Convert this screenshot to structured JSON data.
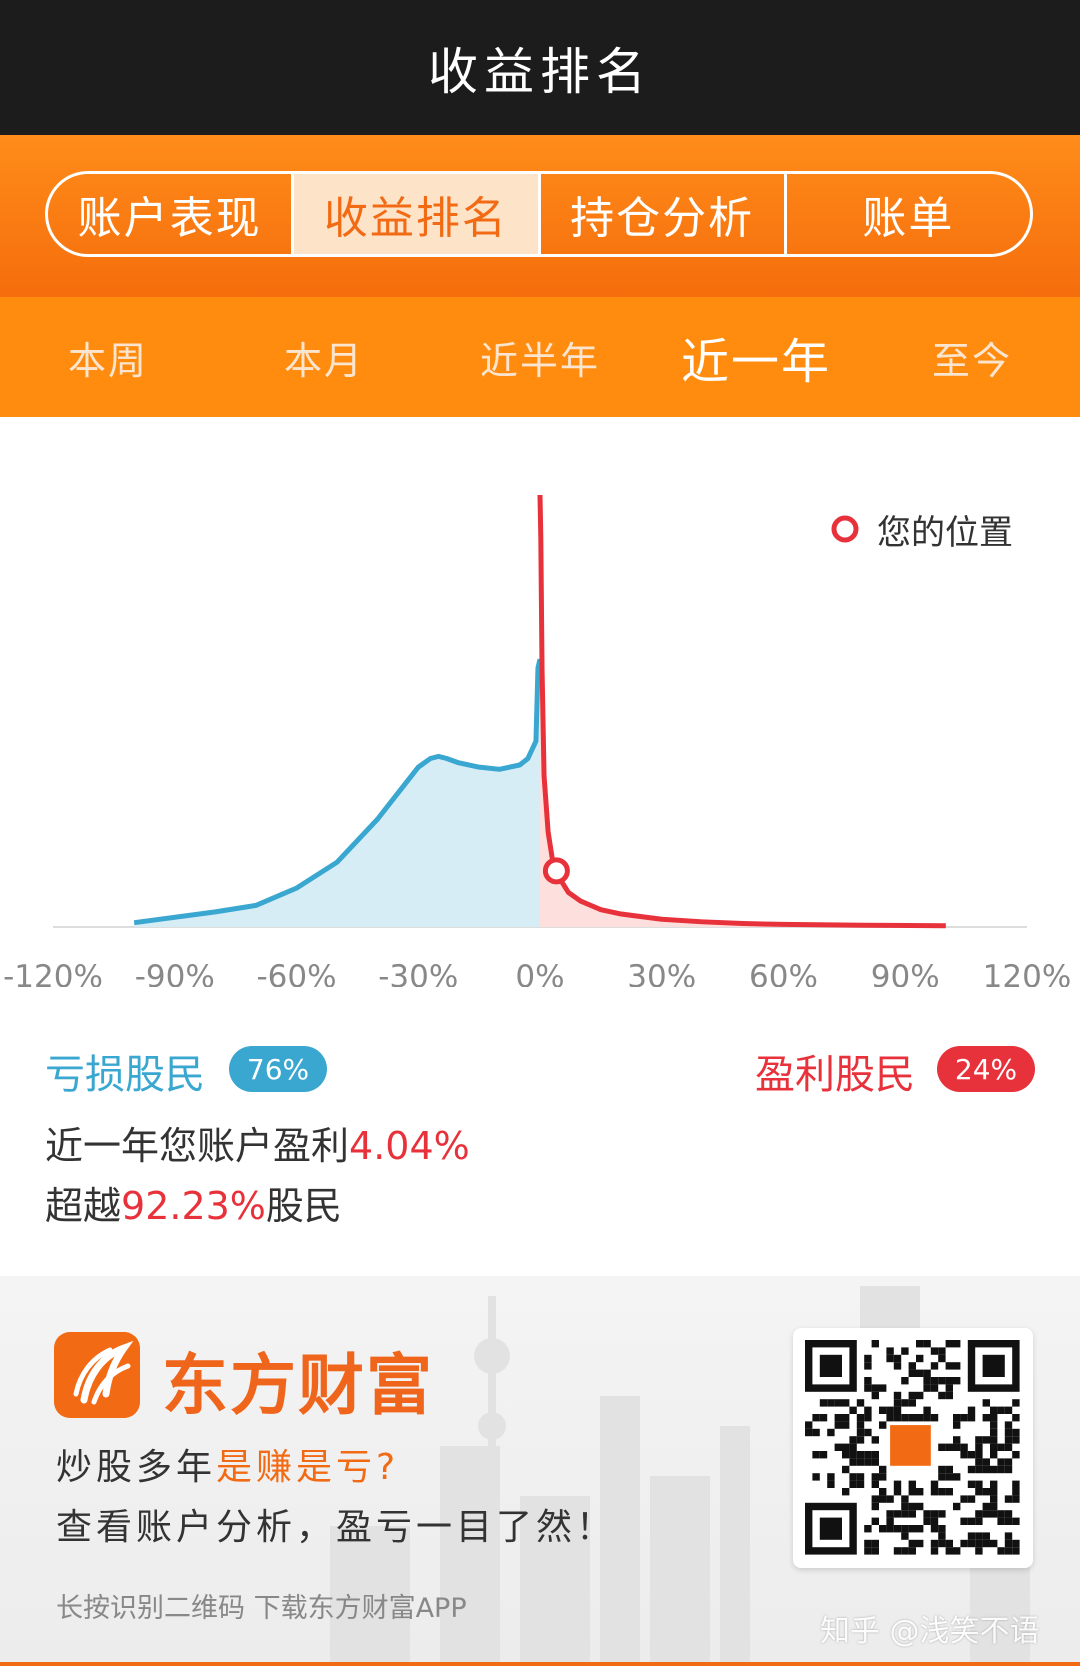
{
  "header": {
    "title": "收益排名"
  },
  "tabs": [
    {
      "label": "账户表现"
    },
    {
      "label": "收益排名"
    },
    {
      "label": "持仓分析"
    },
    {
      "label": "账单"
    }
  ],
  "periods": [
    {
      "label": "本周"
    },
    {
      "label": "本月"
    },
    {
      "label": "近半年"
    },
    {
      "label": "近一年"
    },
    {
      "label": "至今"
    }
  ],
  "legend": {
    "label": "您的位置"
  },
  "colors": {
    "loss": "#3aa7d0",
    "gain": "#e8323b",
    "accent": "#f26a14",
    "header": "#1c1c1c"
  },
  "chart_data": {
    "type": "area",
    "xlim": [
      -120,
      120
    ],
    "x_ticks": [
      "-120%",
      "-90%",
      "-60%",
      "-30%",
      "0%",
      "30%",
      "60%",
      "90%",
      "120%"
    ],
    "series": [
      {
        "x": [
          -100,
          -80,
          -70,
          -60,
          -50,
          -40,
          -35,
          -30,
          -27,
          -25,
          -23,
          -20,
          -15,
          -10,
          -5,
          -3,
          -1,
          -0.5,
          0
        ],
        "y": [
          0.01,
          0.035,
          0.05,
          0.09,
          0.15,
          0.25,
          0.31,
          0.37,
          0.39,
          0.395,
          0.39,
          0.38,
          0.37,
          0.365,
          0.375,
          0.39,
          0.43,
          0.6,
          0.62
        ]
      },
      {
        "x": [
          0,
          0.2,
          0.5,
          1,
          2,
          3,
          4,
          5,
          7,
          10,
          15,
          20,
          30,
          40,
          50,
          60,
          80,
          100
        ],
        "y": [
          1.0,
          0.9,
          0.6,
          0.35,
          0.22,
          0.16,
          0.13,
          0.11,
          0.08,
          0.06,
          0.04,
          0.03,
          0.018,
          0.012,
          0.008,
          0.006,
          0.004,
          0.003
        ]
      }
    ],
    "marker": {
      "x": 4.04,
      "y": 0.13
    }
  },
  "summary": {
    "loss_label": "亏损股民",
    "loss_pct": "76%",
    "gain_label": "盈利股民",
    "gain_pct": "24%",
    "line1_prefix": "近一年您账户盈利",
    "line1_value": "4.04%",
    "line2_prefix": "超越",
    "line2_value": "92.23%",
    "line2_suffix": "股民"
  },
  "banner": {
    "brand": "东方财富",
    "slogan1_a": "炒股多年",
    "slogan1_b": "是赚是亏?",
    "slogan2": "查看账户分析，盈亏一目了然！",
    "download": "长按识别二维码 下载东方财富APP",
    "watermark": "知乎 @浅笑不语"
  }
}
